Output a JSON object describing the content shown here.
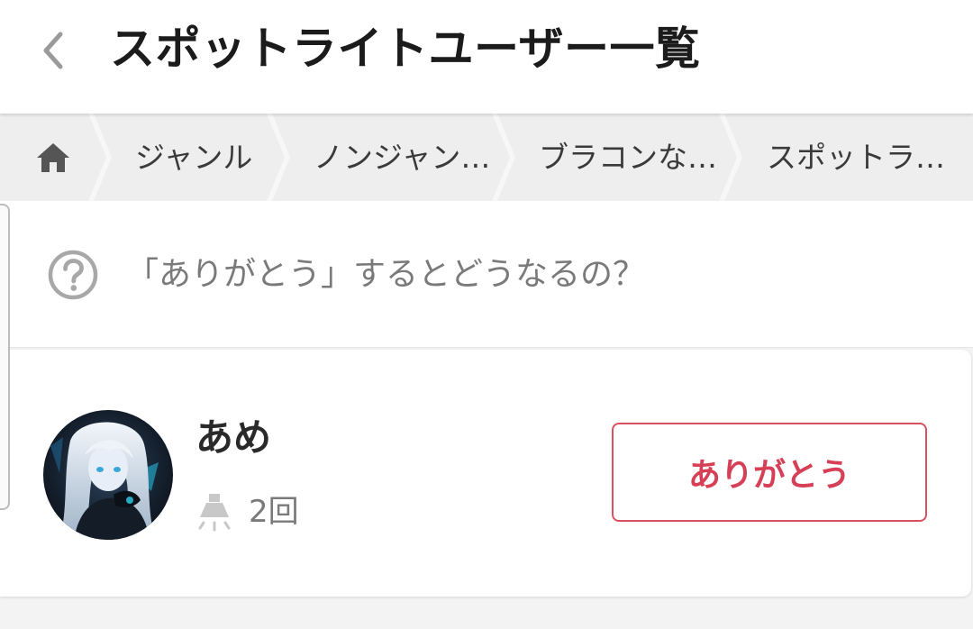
{
  "header": {
    "title": "スポットライトユーザー一覧",
    "back_icon": "chevron-left-icon"
  },
  "breadcrumb": {
    "home_icon": "home-icon",
    "items": [
      {
        "label": "ジャンル"
      },
      {
        "label": "ノンジャン…"
      },
      {
        "label": "ブラコンな…"
      },
      {
        "label": "スポットラ…"
      }
    ]
  },
  "help": {
    "icon": "question-circle-icon",
    "text": "「ありがとう」するとどうなるの？"
  },
  "users": [
    {
      "name": "あめ",
      "avatar_icon": "avatar",
      "stat_icon": "spotlight-icon",
      "count": "2回",
      "button_label": "ありがとう"
    }
  ],
  "colors": {
    "accent": "#d63f55",
    "accent_border": "#d8515f",
    "muted_text": "#7a7a7a",
    "breadcrumb_bg": "#eeeeee",
    "breadcrumb_chevron": "#f7f7f7"
  }
}
